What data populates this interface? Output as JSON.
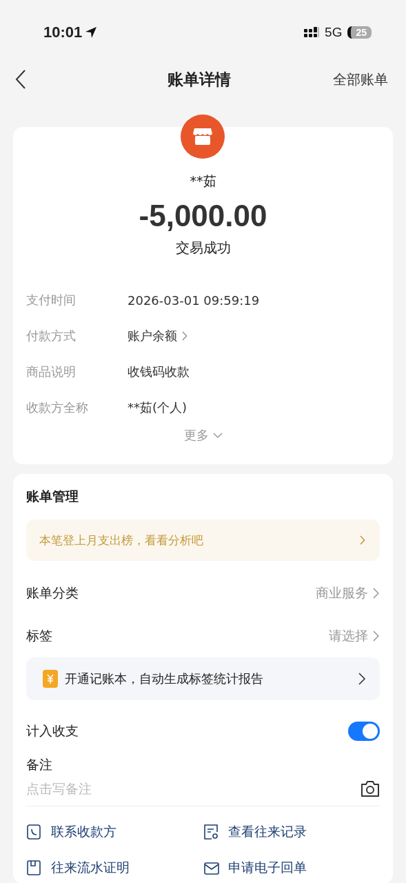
{
  "status_bar": {
    "time": "10:01",
    "network": "5G",
    "battery": "25"
  },
  "nav": {
    "title": "账单详情",
    "action": "全部账单"
  },
  "summary": {
    "payee": "**茹",
    "amount": "-5,000.00",
    "status": "交易成功",
    "details": [
      {
        "label": "支付时间",
        "value": "2026-03-01 09:59:19",
        "link": false
      },
      {
        "label": "付款方式",
        "value": "账户余额",
        "link": true
      },
      {
        "label": "商品说明",
        "value": "收钱码收款",
        "link": false
      },
      {
        "label": "收款方全称",
        "value": "**茹(个人)",
        "link": false
      }
    ],
    "more": "更多"
  },
  "management": {
    "title": "账单管理",
    "notice": "本笔登上月支出榜，看看分析吧",
    "rows": [
      {
        "label": "账单分类",
        "value": "商业服务"
      },
      {
        "label": "标签",
        "value": "请选择"
      }
    ],
    "promo": "开通记账本，自动生成标签统计报告",
    "include": {
      "label": "计入收支",
      "on": true
    },
    "remark": {
      "label": "备注",
      "placeholder": "点击写备注"
    },
    "actions": [
      {
        "kind": "phone",
        "label": "联系收款方"
      },
      {
        "kind": "record",
        "label": "查看往来记录"
      },
      {
        "kind": "statement",
        "label": "往来流水证明"
      },
      {
        "kind": "receipt",
        "label": "申请电子回单"
      }
    ]
  }
}
